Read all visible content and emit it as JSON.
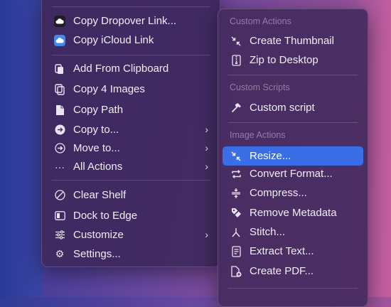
{
  "main_menu": {
    "items": [
      {
        "label": "Copy Dropover Link...",
        "icon": "dropover-cloud-icon"
      },
      {
        "label": "Copy iCloud Link",
        "icon": "icloud-icon"
      },
      {
        "label": "Add From Clipboard",
        "icon": "clipboard-icon"
      },
      {
        "label": "Copy 4 Images",
        "icon": "copy-images-icon"
      },
      {
        "label": "Copy Path",
        "icon": "document-icon"
      },
      {
        "label": "Copy to...",
        "icon": "arrow-right-circle-icon"
      },
      {
        "label": "Move to...",
        "icon": "arrow-right-circle-outline-icon"
      },
      {
        "label": "All Actions",
        "icon": "ellipsis-icon"
      },
      {
        "label": "Clear Shelf",
        "icon": "clear-icon"
      },
      {
        "label": "Dock to Edge",
        "icon": "dock-icon"
      },
      {
        "label": "Customize",
        "icon": "sliders-icon"
      },
      {
        "label": "Settings...",
        "icon": "gear-icon"
      }
    ]
  },
  "sub_menu": {
    "headers": {
      "custom_actions": "Custom Actions",
      "custom_scripts": "Custom Scripts",
      "image_actions": "Image Actions"
    },
    "items": [
      {
        "label": "Create Thumbnail",
        "icon": "shrink-arrows-icon"
      },
      {
        "label": "Zip to Desktop",
        "icon": "zip-icon"
      },
      {
        "label": "Custom script",
        "icon": "hammer-icon"
      },
      {
        "label": "Resize...",
        "icon": "resize-arrows-icon"
      },
      {
        "label": "Convert Format...",
        "icon": "convert-arrows-icon"
      },
      {
        "label": "Compress...",
        "icon": "compress-icon"
      },
      {
        "label": "Remove Metadata",
        "icon": "tag-slash-icon"
      },
      {
        "label": "Stitch...",
        "icon": "stitch-icon"
      },
      {
        "label": "Extract Text...",
        "icon": "text-scan-icon"
      },
      {
        "label": "Create PDF...",
        "icon": "pdf-add-icon"
      }
    ]
  },
  "colors": {
    "highlight": "#3a6ee6",
    "dropover_badge": "#1e1e24",
    "icloud_badge": "#3c8cf0"
  }
}
